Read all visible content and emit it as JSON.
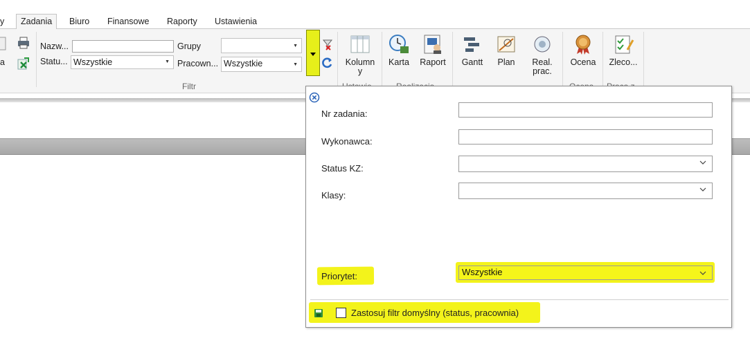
{
  "tabs": [
    {
      "label": "y"
    },
    {
      "label": "Zadania"
    },
    {
      "label": "Biuro"
    },
    {
      "label": "Finansowe"
    },
    {
      "label": "Raporty"
    },
    {
      "label": "Ustawienia"
    }
  ],
  "ribbon": {
    "left_partial_label": "a",
    "filter": {
      "name_label": "Nazw...",
      "name_value": "",
      "status_label": "Statu...",
      "status_value": "Wszystkie",
      "groups_label": "Grupy",
      "groups_value": "",
      "workshop_label": "Pracown...",
      "workshop_value": "Wszystkie",
      "group_title": "Filtr"
    },
    "buttons": {
      "columns": "Kolumn y",
      "card": "Karta",
      "report": "Raport",
      "gantt": "Gantt",
      "plan": "Plan",
      "real_line1": "Real.",
      "real_line2": "prac.",
      "rating": "Ocena",
      "order": "Zleco..."
    },
    "group_labels": {
      "settings": "Ustawie",
      "realization": "Realizacja",
      "rating": "Ocena",
      "work": "Praca z"
    }
  },
  "popup": {
    "fields": [
      {
        "label": "Nr zadania:",
        "value": "",
        "type": "text"
      },
      {
        "label": "Wykonawca:",
        "value": "",
        "type": "text"
      },
      {
        "label": "Status KZ:",
        "value": "",
        "type": "select"
      },
      {
        "label": "Klasy:",
        "value": "",
        "type": "select"
      }
    ],
    "priority": {
      "label": "Priorytet:",
      "value": "Wszystkie"
    },
    "default_filter": {
      "label": "Zastosuj filtr domyślny (status, pracownia)",
      "checked": false
    }
  },
  "colors": {
    "highlight": "#f5f51a",
    "ribbon_bg": "#f5f5f5",
    "band_gray": "#b3b3b3"
  },
  "icons": [
    "printer-icon",
    "excel-export-icon",
    "filter-clear-icon",
    "refresh-icon",
    "columns-icon",
    "card-clock-icon",
    "report-user-icon",
    "gantt-icon",
    "plan-icon",
    "real-work-icon",
    "medal-icon",
    "checklist-icon",
    "close-circle-icon",
    "save-disk-icon",
    "chevron-down-icon"
  ]
}
